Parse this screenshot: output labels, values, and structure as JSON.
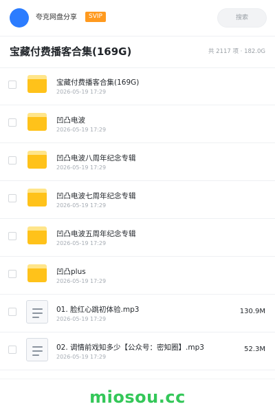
{
  "header": {
    "username": "夸克网盘分享",
    "badge": "SVIP",
    "search_placeholder": "搜索"
  },
  "folder": {
    "title": "宝藏付费播客合集(169G)",
    "meta": "共 2117 项 · 182.0G"
  },
  "files": [
    {
      "type": "folder",
      "name": "宝藏付费播客合集(169G)",
      "date": "2026-05-19 17:29",
      "size": ""
    },
    {
      "type": "folder",
      "name": "凹凸电波",
      "date": "2026-05-19 17:29",
      "size": ""
    },
    {
      "type": "folder",
      "name": "凹凸电波八周年纪念专辑",
      "date": "2026-05-19 17:29",
      "size": ""
    },
    {
      "type": "folder",
      "name": "凹凸电波七周年纪念专辑",
      "date": "2026-05-19 17:29",
      "size": ""
    },
    {
      "type": "folder",
      "name": "凹凸电波五周年纪念专辑",
      "date": "2026-05-19 17:29",
      "size": ""
    },
    {
      "type": "folder",
      "name": "凹凸plus",
      "date": "2026-05-19 17:29",
      "size": ""
    },
    {
      "type": "file",
      "name": "01. 脸红心跳初体验.mp3",
      "date": "2026-05-19 17:29",
      "size": "130.9M"
    },
    {
      "type": "file",
      "name": "02. 调情前戏知多少【公众号：密知圈】.mp3",
      "date": "2026-05-19 17:29",
      "size": "52.3M"
    }
  ],
  "watermark": "miosou.cc",
  "colors": {
    "avatar": "#2b7cff",
    "badge": "#ff9a1f",
    "folder": "#ffc21a",
    "watermark": "#34c759"
  },
  "icons": {
    "folder": "folder-icon",
    "file": "audio-file-icon"
  }
}
